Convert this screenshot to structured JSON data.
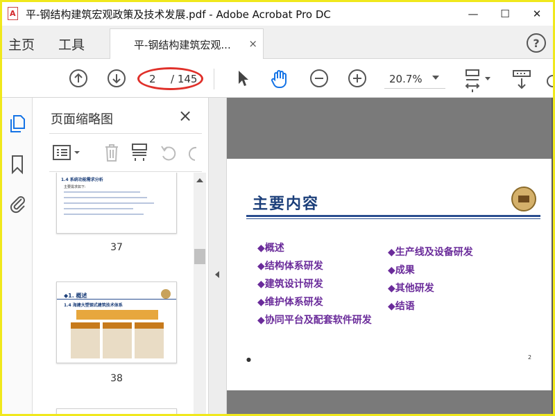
{
  "window": {
    "title": "平-钢结构建筑宏观政策及技术发展.pdf - Adobe Acrobat Pro DC",
    "minimize": "—",
    "maximize": "☐",
    "close": "✕"
  },
  "tabs": {
    "home": "主页",
    "tools": "工具",
    "document": "平-钢结构建筑宏观...",
    "document_close": "×",
    "help": "?"
  },
  "toolbar": {
    "page_current": "2",
    "page_total": "/ 145",
    "zoom": "20.7%"
  },
  "panel": {
    "title": "页面缩略图",
    "close": "×",
    "thumbnails": [
      {
        "page": "37",
        "heading": "1.4 系统功能需求分析"
      },
      {
        "page": "38",
        "heading": "◆1. 概述",
        "subheading": "1.4 海建大塑钢式建筑技术体系"
      }
    ]
  },
  "slide": {
    "title": "主要内容",
    "left_items": [
      "◆概述",
      "◆结构体系研发",
      "◆建筑设计研发",
      "◆维护体系研发",
      "◆协同平台及配套软件研发"
    ],
    "right_items": [
      "◆生产线及设备研发",
      "◆成果",
      "◆其他研发",
      "◆结语"
    ],
    "page_mark": "2",
    "bullet_mark": "●"
  },
  "colors": {
    "highlight_oval": "#e0302a",
    "slide_title": "#1c3f7a",
    "slide_items": "#6a2b9a",
    "outer_frame": "#f0e81c",
    "hand_tool_active": "#1473e6"
  }
}
